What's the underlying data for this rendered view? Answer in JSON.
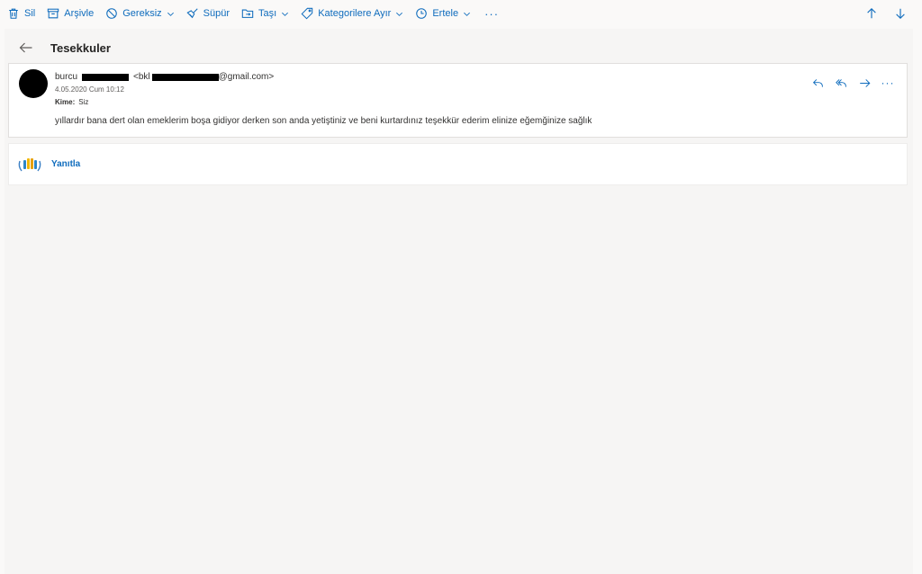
{
  "toolbar": {
    "delete_label": "Sil",
    "archive_label": "Arşivle",
    "junk_label": "Gereksiz",
    "sweep_label": "Süpür",
    "move_label": "Taşı",
    "categorize_label": "Kategorilere Ayır",
    "snooze_label": "Ertele",
    "more_label": "···"
  },
  "message": {
    "subject": "Tesekkuler",
    "sender_name": "burcu",
    "sender_email_prefix": "<bkl",
    "sender_email_domain": "@gmail.com>",
    "date": "4.05.2020 Cum 10:12",
    "to_label": "Kime:",
    "to_value": "Siz",
    "body": "yıllardır bana dert olan emeklerim boşa gidiyor derken son anda yetiştiniz ve beni kurtardınız teşekkür ederim elinize eğemğinize sağlık",
    "more_label": "···"
  },
  "reply": {
    "label": "Yanıtla"
  },
  "colors": {
    "accent": "#0f6cbd",
    "background": "#faf9f8"
  }
}
